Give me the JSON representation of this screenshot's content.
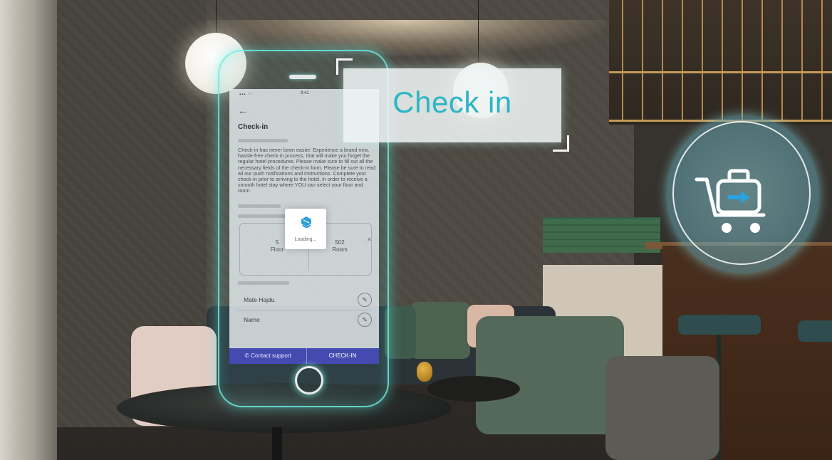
{
  "scene": {
    "banner_text": "Check in"
  },
  "phone": {
    "status_time": "9:41",
    "screen_title": "Check-in",
    "description": "Check-in has never been easier. Experience a brand new, hassle-free check-in process, that will make you forget the regular hotel procedures. Please make sure to fill out all the necessary fields of the check-in form. Please be sure to read all our push notifications and instructions. Complete your check-in prior to arriving to the hotel, in order to receive a smooth hotel stay where YOU can select your floor and room.",
    "room": {
      "floor_value": "5",
      "floor_label": "Floor",
      "room_value": "502",
      "room_label": "Room"
    },
    "guests": [
      {
        "label": "Mate Hajdu"
      },
      {
        "label": "Name"
      }
    ],
    "contact_support_label": "Contact support",
    "checkin_button_label": "CHECK-IN",
    "loading_label": "Loading..."
  },
  "icons": {
    "back": "back-arrow-icon",
    "edit": "pencil-icon",
    "loading": "loading-logo-icon",
    "support": "phone-icon",
    "luggage": "luggage-cart-icon"
  },
  "colors": {
    "hologram": "#6eebe1",
    "banner_text": "#2bb6c6",
    "action_bar": "#454ab0"
  }
}
